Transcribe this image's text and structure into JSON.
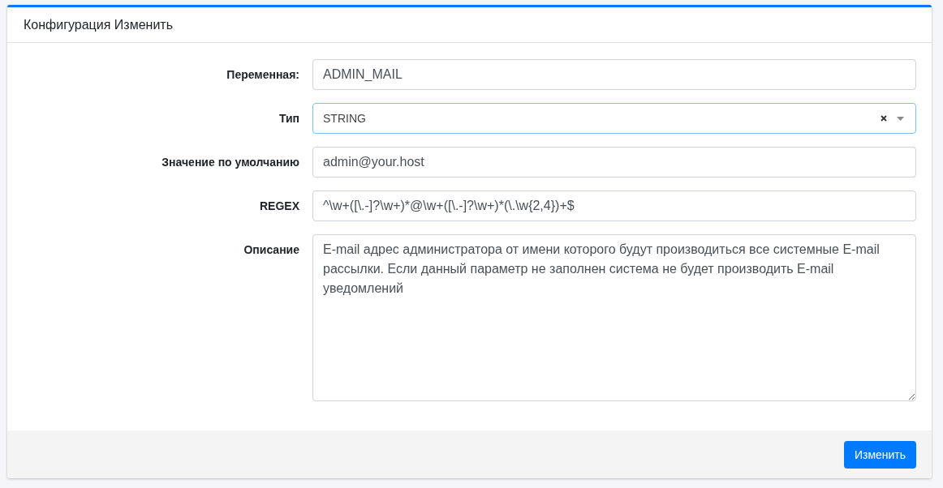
{
  "card": {
    "title": "Конфигурация Изменить"
  },
  "fields": [
    {
      "kind": "text",
      "label": "Переменная:",
      "value": "ADMIN_MAIL",
      "focused": false
    },
    {
      "kind": "select",
      "label": "Тип",
      "value": "STRING",
      "focused": true
    },
    {
      "kind": "text",
      "label": "Значение по умолчанию",
      "value": "admin@your.host",
      "focused": false
    },
    {
      "kind": "text",
      "label": "REGEX",
      "value": "^\\w+([\\.-]?\\w+)*@\\w+([\\.-]?\\w+)*(\\.\\w{2,4})+$",
      "focused": false
    },
    {
      "kind": "textarea",
      "label": "Описание",
      "value": "E-mail адрес администратора от имени которого будут производиться все системные E-mail рассылки. Если данный параметр не заполнен система не будет производить E-mail уведомлений",
      "focused": false
    }
  ],
  "submit_button": "Изменить"
}
